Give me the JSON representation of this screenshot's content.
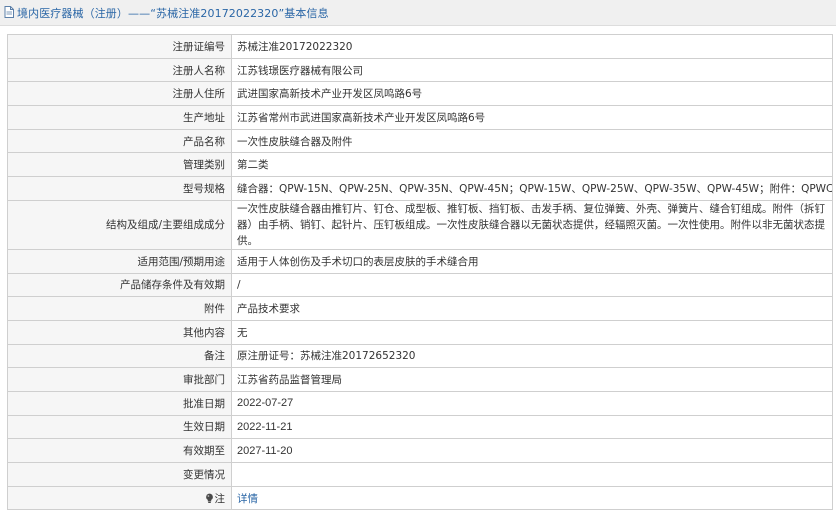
{
  "header": {
    "title": "境内医疗器械（注册）——“苏械注准20172022320”基本信息"
  },
  "rows": [
    {
      "label": "注册证编号",
      "value": "苏械注准20172022320"
    },
    {
      "label": "注册人名称",
      "value": "江苏钱璟医疗器械有限公司"
    },
    {
      "label": "注册人住所",
      "value": "武进国家高新技术产业开发区凤鸣路6号"
    },
    {
      "label": "生产地址",
      "value": "江苏省常州市武进国家高新技术产业开发区凤鸣路6号"
    },
    {
      "label": "产品名称",
      "value": "一次性皮肤缝合器及附件"
    },
    {
      "label": "管理类别",
      "value": "第二类"
    },
    {
      "label": "型号规格",
      "value": "缝合器：QPW-15N、QPW-25N、QPW-35N、QPW-45N；QPW-15W、QPW-25W、QPW-35W、QPW-45W；附件：QPWC"
    },
    {
      "label": "结构及组成/主要组成成分",
      "value": "一次性皮肤缝合器由推钉片、钉仓、成型板、推钉板、挡钉板、击发手柄、复位弹簧、外壳、弹簧片、缝合钉组成。附件（拆钉器）由手柄、销钉、起针片、压钉板组成。一次性皮肤缝合器以无菌状态提供，经辐照灭菌。一次性使用。附件以非无菌状态提供。"
    },
    {
      "label": "适用范围/预期用途",
      "value": "适用于人体创伤及手术切口的表层皮肤的手术缝合用"
    },
    {
      "label": "产品储存条件及有效期",
      "value": "/"
    },
    {
      "label": "附件",
      "value": "产品技术要求"
    },
    {
      "label": "其他内容",
      "value": "无"
    },
    {
      "label": "备注",
      "value": "原注册证号：苏械注准20172652320"
    },
    {
      "label": "审批部门",
      "value": "江苏省药品监督管理局"
    },
    {
      "label": "批准日期",
      "value": "2022-07-27"
    },
    {
      "label": "生效日期",
      "value": "2022-11-21"
    },
    {
      "label": "有效期至",
      "value": "2027-11-20"
    },
    {
      "label": "变更情况",
      "value": ""
    },
    {
      "label": "注",
      "value": "详情"
    }
  ]
}
